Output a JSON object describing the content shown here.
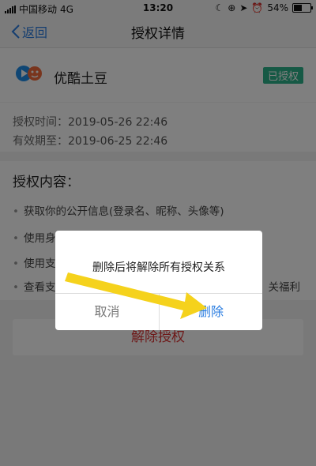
{
  "status": {
    "carrier": "中国移动",
    "network": "4G",
    "time": "13:20",
    "battery": "54%",
    "battery_level": 0.54
  },
  "nav": {
    "back_label": "返回",
    "title": "授权详情"
  },
  "app": {
    "name": "优酷土豆",
    "badge": "已授权",
    "badge_color": "#2db38b"
  },
  "auth_time": {
    "granted_label": "授权时间：",
    "granted_value": "2019-05-26 22:46",
    "expires_label": "有效期至：",
    "expires_value": "2019-06-25 22:46"
  },
  "content": {
    "title": "授权内容：",
    "items": [
      "获取你的公开信息(登录名、昵称、头像等)",
      "使用身",
      "使用支",
      "查看支"
    ],
    "trailing_text": "关福利"
  },
  "revoke_button": "解除授权",
  "dialog": {
    "message": "删除后将解除所有授权关系",
    "cancel": "取消",
    "confirm": "删除",
    "confirm_color": "#2a7de1"
  },
  "annotation": {
    "arrow_color": "#f5d21c"
  }
}
